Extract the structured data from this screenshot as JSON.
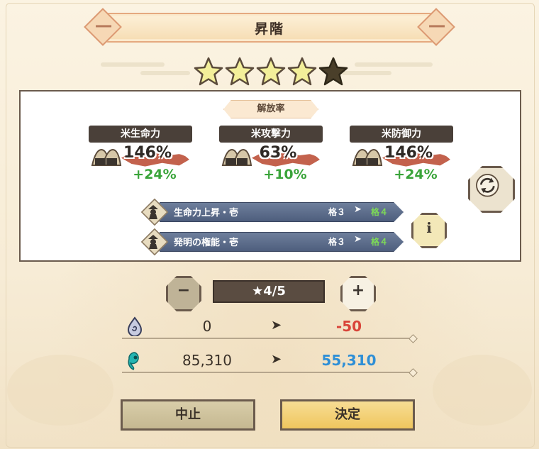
{
  "header": {
    "title": "昇階"
  },
  "stars": {
    "filled": 4,
    "total": 5
  },
  "panel": {
    "tag": "解放率",
    "stats": [
      {
        "label": "米生命力",
        "percent": "146%",
        "increase": "+24%"
      },
      {
        "label": "米攻撃力",
        "percent": "63%",
        "increase": "+10%"
      },
      {
        "label": "米防御力",
        "percent": "146%",
        "increase": "+24%"
      }
    ],
    "skills": [
      {
        "name": "生命力上昇・壱",
        "from": "格３",
        "arrow": "➤",
        "to": "格４"
      },
      {
        "name": "発明の権能・壱",
        "from": "格３",
        "arrow": "➤",
        "to": "格４"
      }
    ],
    "refresh_icon": "refresh-icon",
    "info_label": "i"
  },
  "stepper": {
    "minus_label": "−",
    "plus_label": "+",
    "value": "★4/5"
  },
  "resources": [
    {
      "icon": "spirit-drop-icon",
      "from": "0",
      "arrow": "➤",
      "to": "-50",
      "to_color": "#d9453a"
    },
    {
      "icon": "magatama-icon",
      "from": "85,310",
      "arrow": "➤",
      "to": "55,310",
      "to_color": "#2f8fd6"
    }
  ],
  "buttons": {
    "cancel": "中止",
    "confirm": "決定"
  }
}
